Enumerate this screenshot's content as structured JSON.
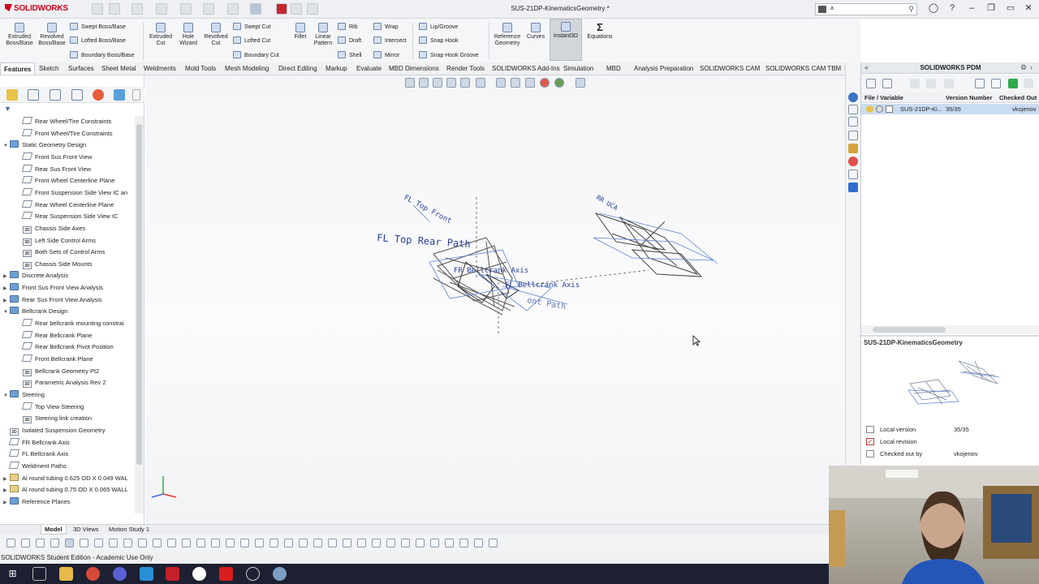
{
  "app": {
    "brand": "SOLIDWORKS",
    "document_title": "SUS-21DP-KinematicsGeometry *",
    "search_text": "a"
  },
  "ribbon": {
    "extruded_boss": "Extruded\nBoss/Base",
    "revolved_boss": "Revolved\nBoss/Base",
    "swept_boss": "Swept Boss/Base",
    "lofted_boss": "Lofted Boss/Base",
    "boundary_boss": "Boundary Boss/Base",
    "extruded_cut": "Extruded\nCut",
    "hole_wizard": "Hole\nWizard",
    "revolved_cut": "Revolved\nCut",
    "swept_cut": "Swept Cut",
    "lofted_cut": "Lofted Cut",
    "boundary_cut": "Boundary Cut",
    "fillet": "Fillet",
    "linear_pattern": "Linear\nPattern",
    "rib": "Rib",
    "draft": "Draft",
    "shell": "Shell",
    "wrap": "Wrap",
    "intersect": "Intersect",
    "mirror": "Mirror",
    "lip_groove": "Lip/Groove",
    "snap_hook": "Snap Hook",
    "snap_hook_groove": "Snap Hook Groove",
    "reference_geometry": "Reference\nGeometry",
    "curves": "Curves",
    "instant3d": "Instant3D",
    "equations": "Equations"
  },
  "tabs": [
    "Features",
    "Sketch",
    "Surfaces",
    "Sheet Metal",
    "Weldments",
    "Mold Tools",
    "Mesh Modeling",
    "Direct Editing",
    "Markup",
    "Evaluate",
    "MBD Dimensions",
    "SOLIDWORKS Add-Ins",
    "Render Tools",
    "Simulation",
    "MBD",
    "Analysis Preparation",
    "SOLIDWORKS CAM",
    "SOLIDWORKS CAM TBM"
  ],
  "tree": [
    {
      "label": "Rear Wheel/Tire Constraints",
      "indent": 2,
      "icon": "plane",
      "exp": ""
    },
    {
      "label": "Front Wheel/Tire Constraints",
      "indent": 2,
      "icon": "plane",
      "exp": ""
    },
    {
      "label": "Static Geometry Design",
      "indent": 1,
      "icon": "folder",
      "exp": "v"
    },
    {
      "label": "Front Sus Front View",
      "indent": 2,
      "icon": "plane",
      "exp": ""
    },
    {
      "label": "Rear Sus Front View",
      "indent": 2,
      "icon": "plane",
      "exp": ""
    },
    {
      "label": "Front Wheel Centerline Plane",
      "indent": 2,
      "icon": "plane",
      "exp": ""
    },
    {
      "label": "Front Suspension Side View IC an",
      "indent": 2,
      "icon": "plane",
      "exp": ""
    },
    {
      "label": "Rear Wheel Centerline Plane",
      "indent": 2,
      "icon": "plane",
      "exp": ""
    },
    {
      "label": "Rear Suspension Side View IC",
      "indent": 2,
      "icon": "plane",
      "exp": ""
    },
    {
      "label": "Chassis Side Axes",
      "indent": 2,
      "icon": "sk3d",
      "exp": ""
    },
    {
      "label": "Left Side Control Arms",
      "indent": 2,
      "icon": "sk3d",
      "exp": ""
    },
    {
      "label": "Both Sets of Control Arms",
      "indent": 2,
      "icon": "sk3d",
      "exp": ""
    },
    {
      "label": "Chassis Side Mounts",
      "indent": 2,
      "icon": "sk3d",
      "exp": ""
    },
    {
      "label": "Discrete Analysis",
      "indent": 1,
      "icon": "folder",
      "exp": ">"
    },
    {
      "label": "Front Sus Front View Analysis",
      "indent": 1,
      "icon": "folder",
      "exp": ">"
    },
    {
      "label": "Rear Sus Front View Analysis",
      "indent": 1,
      "icon": "folder",
      "exp": ">"
    },
    {
      "label": "Bellcrank Design",
      "indent": 1,
      "icon": "folder",
      "exp": "v"
    },
    {
      "label": "Rear bellcrank mounting constrai",
      "indent": 2,
      "icon": "plane",
      "exp": ""
    },
    {
      "label": "Rear Bellcrank Plane",
      "indent": 2,
      "icon": "plane",
      "exp": ""
    },
    {
      "label": "Rear Bellcrank Pivot Position",
      "indent": 2,
      "icon": "plane",
      "exp": ""
    },
    {
      "label": "Front Bellcrank Plane",
      "indent": 2,
      "icon": "plane",
      "exp": ""
    },
    {
      "label": "Bellcrank Geometry Pt2",
      "indent": 2,
      "icon": "sk3d",
      "exp": ""
    },
    {
      "label": "Parametric Analysis Rev 2",
      "indent": 2,
      "icon": "sk3d",
      "exp": ""
    },
    {
      "label": "Steering",
      "indent": 1,
      "icon": "folder",
      "exp": "v"
    },
    {
      "label": "Top View Steering",
      "indent": 2,
      "icon": "plane",
      "exp": ""
    },
    {
      "label": "Steering link creation",
      "indent": 2,
      "icon": "sk3d",
      "exp": ""
    },
    {
      "label": "Isolated Suspension Geometry",
      "indent": 0,
      "icon": "sk3d",
      "exp": ""
    },
    {
      "label": "FR Bellcrank Axis",
      "indent": 0,
      "icon": "plane",
      "exp": ""
    },
    {
      "label": "FL Bellcrank Axis",
      "indent": 0,
      "icon": "plane",
      "exp": ""
    },
    {
      "label": "Weldment Paths",
      "indent": 0,
      "icon": "plane",
      "exp": ""
    },
    {
      "label": "Al round tubing 0.625 OD X 0.049 WAL",
      "indent": 0,
      "icon": "tan",
      "exp": ">"
    },
    {
      "label": "Al round tubing 0.75 OD X 0.065 WALL",
      "indent": 0,
      "icon": "tan",
      "exp": ">"
    },
    {
      "label": "Reference Planes",
      "indent": 0,
      "icon": "folder",
      "exp": ">"
    }
  ],
  "viewport_labels": {
    "fl_top_front": "FL Top Front",
    "fl_top_rear": "FL Top Rear Path",
    "fr_bellcrank": "FR Bellcrank Axis",
    "fl_bellcrank": "FL Bellcrank Axis",
    "front_path": "ont Path",
    "rr_top": "RR UCA"
  },
  "pdm": {
    "title": "SOLIDWORKS PDM",
    "columns": {
      "file": "File / Variable",
      "version": "Version Number",
      "checked": "Checked Out"
    },
    "row": {
      "file": "SUS-21DP-Ki...",
      "version": "35/35",
      "checked": "vkojenov"
    },
    "preview_title": "SUS-21DP-KinematicsGeometry",
    "props": [
      {
        "key": "Local version",
        "value": "35/35"
      },
      {
        "key": "Local revision",
        "value": ""
      },
      {
        "key": "Checked out by",
        "value": "vkojenov"
      }
    ]
  },
  "bottom_tabs": [
    "Model",
    "3D Views",
    "Motion Study 1"
  ],
  "status": "SOLIDWORKS Student Edition - Academic Use Only",
  "colors": {
    "brand": "#d0021b",
    "accent": "#2540a0",
    "selection": "#c9dcf2",
    "taskbar": "#1c2030"
  }
}
